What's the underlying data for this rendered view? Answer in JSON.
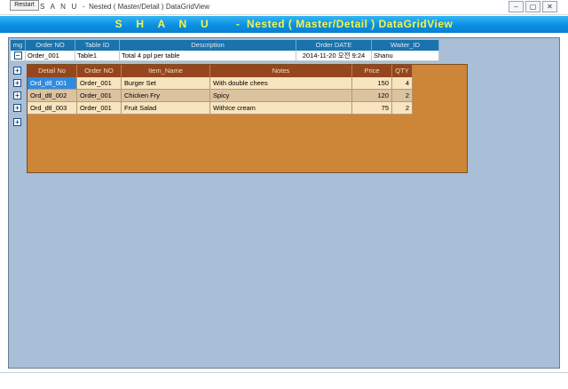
{
  "window": {
    "restart_label": "Restart",
    "title": "S   A   N   U   -  Nested ( Master/Detail ) DataGridView",
    "controls": [
      "–",
      "▢",
      "✕"
    ]
  },
  "banner": {
    "text": "S    H    A    N    U        -  Nested ( Master/Detail ) DataGridView"
  },
  "master": {
    "columns": [
      "mg",
      "Order NO",
      "Table ID",
      "Description",
      "Order DATE",
      "Waiter_ID"
    ],
    "row": {
      "expander": "−",
      "order_no": "Order_001",
      "table_id": "Table1",
      "description": "Total 4 ppl per table",
      "order_date": "2014-11-20 오전 9:24",
      "waiter_id": "Shanu"
    }
  },
  "detail": {
    "columns": [
      "Detail No",
      "Order NO",
      "Item_Name",
      "Notes",
      "Price",
      "QTY"
    ],
    "rows": [
      {
        "detail_no": "Ord_dtl_001",
        "order_no": "Order_001",
        "item_name": "Burger Set",
        "notes": "With double chees",
        "price": "150",
        "qty": "4"
      },
      {
        "detail_no": "Ord_dtl_002",
        "order_no": "Order_001",
        "item_name": "Chicken Fry",
        "notes": "Spicy",
        "price": "120",
        "qty": "2"
      },
      {
        "detail_no": "Ord_dtl_003",
        "order_no": "Order_001",
        "item_name": "Fruit Salad",
        "notes": "WithIce cream",
        "price": "75",
        "qty": "2"
      }
    ],
    "row_expander": "+"
  }
}
